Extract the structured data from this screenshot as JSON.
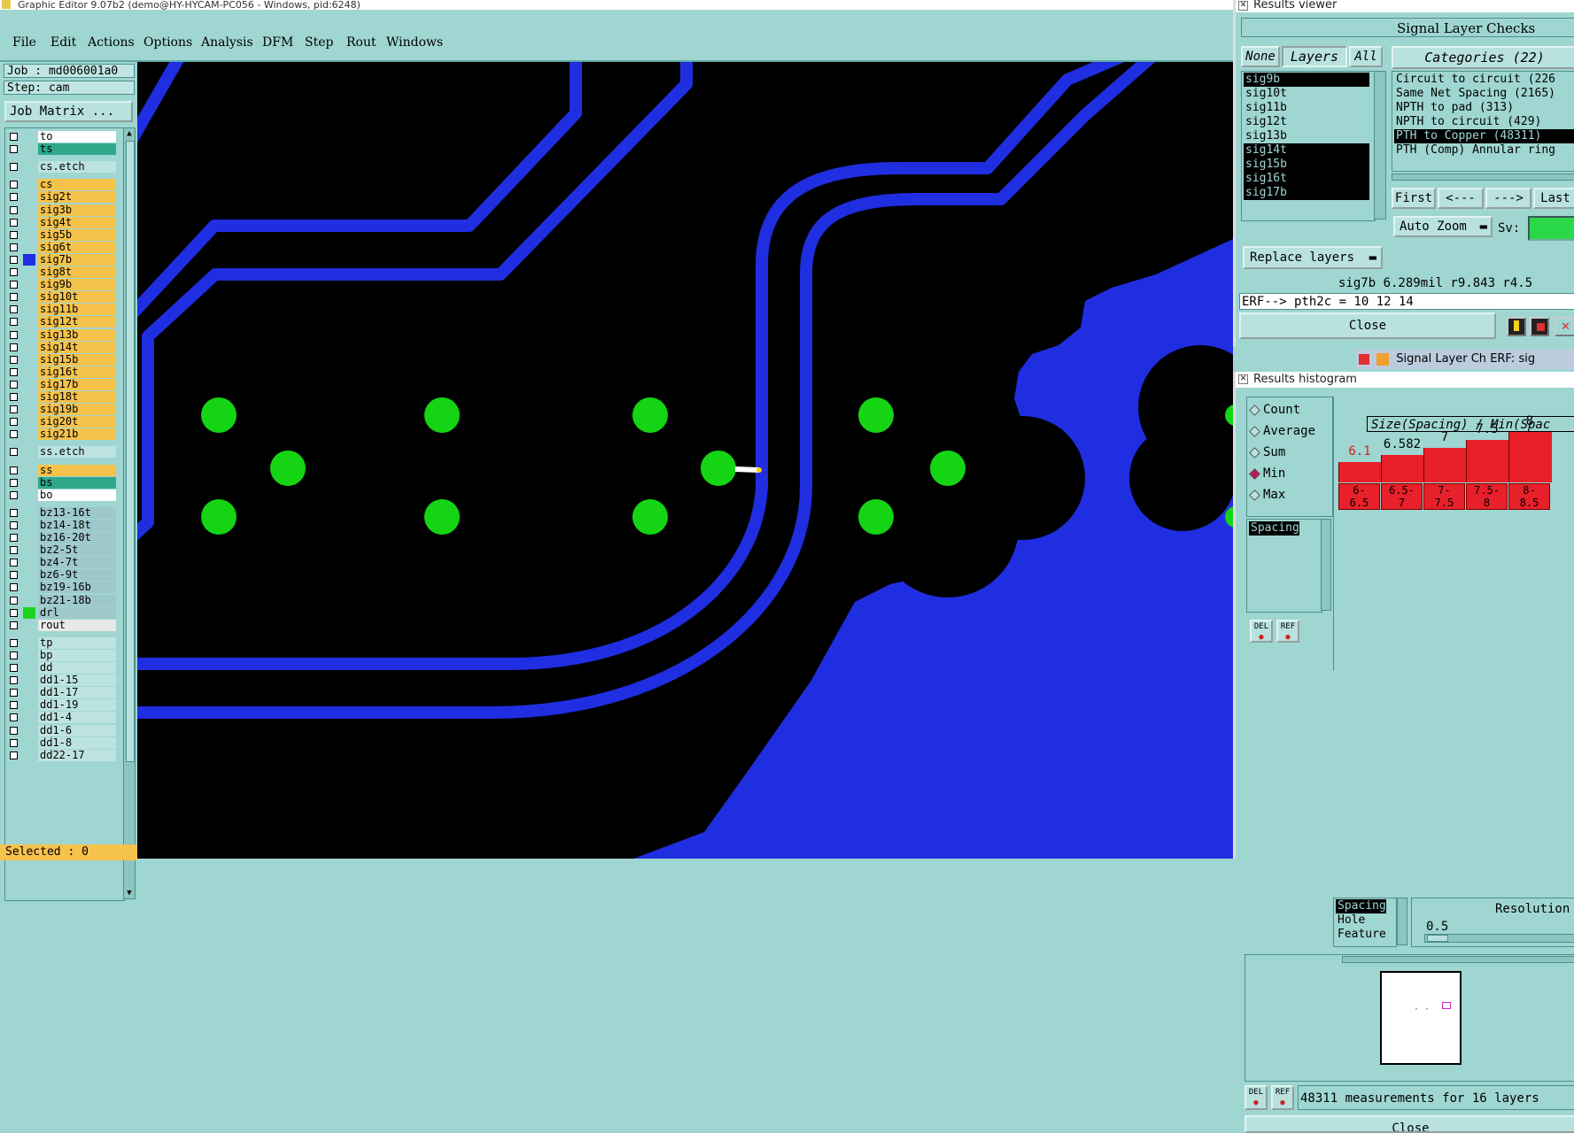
{
  "main_window": {
    "title": "Graphic Editor 9.07b2 (demo@HY-HYCAM-PC056 - Windows, pid:6248)",
    "menu": [
      "File",
      "Edit",
      "Actions",
      "Options",
      "Analysis",
      "DFM",
      "Step",
      "Rout",
      "Windows"
    ]
  },
  "left_panel": {
    "job": "Job : md006001a0",
    "step": "Step: cam",
    "job_matrix": "Job Matrix ...",
    "selected": "Selected : 0",
    "layers": [
      {
        "name": "to",
        "color": "#ffffff"
      },
      {
        "name": "ts",
        "color": "#2fa88c"
      },
      {
        "name": "cs.etch",
        "color": "#bde3e0"
      },
      {
        "name": "cs",
        "color": "#f5c24c"
      },
      {
        "name": "sig2t",
        "color": "#f5c24c"
      },
      {
        "name": "sig3b",
        "color": "#f5c24c"
      },
      {
        "name": "sig4t",
        "color": "#f5c24c"
      },
      {
        "name": "sig5b",
        "color": "#f5c24c"
      },
      {
        "name": "sig6t",
        "color": "#f5c24c"
      },
      {
        "name": "sig7b",
        "color": "#f5c24c",
        "swatch": "#1f2ee0"
      },
      {
        "name": "sig8t",
        "color": "#f5c24c"
      },
      {
        "name": "sig9b",
        "color": "#f5c24c"
      },
      {
        "name": "sig10t",
        "color": "#f5c24c"
      },
      {
        "name": "sig11b",
        "color": "#f5c24c"
      },
      {
        "name": "sig12t",
        "color": "#f5c24c"
      },
      {
        "name": "sig13b",
        "color": "#f5c24c"
      },
      {
        "name": "sig14t",
        "color": "#f5c24c"
      },
      {
        "name": "sig15b",
        "color": "#f5c24c"
      },
      {
        "name": "sig16t",
        "color": "#f5c24c"
      },
      {
        "name": "sig17b",
        "color": "#f5c24c"
      },
      {
        "name": "sig18t",
        "color": "#f5c24c"
      },
      {
        "name": "sig19b",
        "color": "#f5c24c"
      },
      {
        "name": "sig20t",
        "color": "#f5c24c"
      },
      {
        "name": "sig21b",
        "color": "#f5c24c"
      },
      {
        "name": "ss.etch",
        "color": "#bde3e0"
      },
      {
        "name": "ss",
        "color": "#f5c24c"
      },
      {
        "name": "bs",
        "color": "#2fa88c"
      },
      {
        "name": "bo",
        "color": "#ffffff"
      },
      {
        "name": "bz13-16t",
        "color": "#9ec8cc"
      },
      {
        "name": "bz14-18t",
        "color": "#9ec8cc"
      },
      {
        "name": "bz16-20t",
        "color": "#9ec8cc"
      },
      {
        "name": "bz2-5t",
        "color": "#9ec8cc"
      },
      {
        "name": "bz4-7t",
        "color": "#9ec8cc"
      },
      {
        "name": "bz6-9t",
        "color": "#9ec8cc"
      },
      {
        "name": "bz19-16b",
        "color": "#9ec8cc"
      },
      {
        "name": "bz21-18b",
        "color": "#9ec8cc"
      },
      {
        "name": "drl",
        "color": "#9ec8cc",
        "swatch": "#1dd41d"
      },
      {
        "name": "rout",
        "color": "#e8e8e8"
      },
      {
        "name": "tp",
        "color": "#bde3e0"
      },
      {
        "name": "bp",
        "color": "#bde3e0"
      },
      {
        "name": "dd",
        "color": "#bde3e0"
      },
      {
        "name": "dd1-15",
        "color": "#bde3e0"
      },
      {
        "name": "dd1-17",
        "color": "#bde3e0"
      },
      {
        "name": "dd1-19",
        "color": "#bde3e0"
      },
      {
        "name": "dd1-4",
        "color": "#bde3e0"
      },
      {
        "name": "dd1-6",
        "color": "#bde3e0"
      },
      {
        "name": "dd1-8",
        "color": "#bde3e0"
      },
      {
        "name": "dd22-17",
        "color": "#bde3e0"
      }
    ]
  },
  "results_viewer": {
    "title": "Results viewer",
    "check_name": "Signal Layer Checks",
    "btn_none": "None",
    "btn_layers": "Layers",
    "btn_all": "All",
    "categories_label": "Categories (22)",
    "layers": [
      {
        "name": "sig9b",
        "selected": true
      },
      {
        "name": "sig10t",
        "selected": false
      },
      {
        "name": "sig11b",
        "selected": false
      },
      {
        "name": "sig12t",
        "selected": false
      },
      {
        "name": "sig13b",
        "selected": false
      },
      {
        "name": "sig14t",
        "selected": true
      },
      {
        "name": "sig15b",
        "selected": true
      },
      {
        "name": "sig16t",
        "selected": true
      },
      {
        "name": "sig17b",
        "selected": true
      }
    ],
    "categories": [
      {
        "name": "Circuit to circuit (226",
        "selected": false
      },
      {
        "name": "Same Net Spacing (2165)",
        "selected": false
      },
      {
        "name": "NPTH to pad (313)",
        "selected": false
      },
      {
        "name": "NPTH to circuit (429)",
        "selected": false
      },
      {
        "name": "PTH to Copper (48311)",
        "selected": true
      },
      {
        "name": "PTH (Comp) Annular ring",
        "selected": false
      }
    ],
    "nav": {
      "first": "First",
      "prev": "<---",
      "next": "--->",
      "last": "Last"
    },
    "auto_zoom": "Auto Zoom",
    "sv_label": "Sv:",
    "replace_layers": "Replace layers",
    "status": "sig7b 6.289mil  r9.843  r4.5",
    "erf": "ERF--> pth2c = 10 12 14",
    "close": "Close",
    "tab_partial": "Signal Layer Ch",
    "tab_partial2": "ERF:",
    "tab_partial3": "sig"
  },
  "histogram": {
    "title": "Results histogram",
    "modes": [
      {
        "label": "Count",
        "on": false
      },
      {
        "label": "Average",
        "on": false
      },
      {
        "label": "Sum",
        "on": false
      },
      {
        "label": "Min",
        "on": true
      },
      {
        "label": "Max",
        "on": false
      }
    ],
    "left_list_item": "Spacing",
    "header": "Size(Spacing) / Min(Spac",
    "bars": [
      {
        "label": "6.1",
        "value": 6.1,
        "range": "6-\n6.5",
        "red": true
      },
      {
        "label": "6.582",
        "value": 6.582,
        "range": "6.5-\n7"
      },
      {
        "label": "7",
        "value": 7,
        "range": "7-\n7.5"
      },
      {
        "label": "7.5",
        "value": 7.5,
        "range": "7.5-\n8"
      },
      {
        "label": "8",
        "value": 8,
        "range": "8-\n8.5"
      }
    ],
    "y_min": 5.5,
    "y_max": 8,
    "attr_list": [
      "Spacing",
      "Hole",
      "Feature"
    ],
    "resolution_label": "Resolution",
    "resolution_value": "0.5",
    "measurements": "48311 measurements for 16 layers",
    "close_partial": "Close",
    "del": "DEL",
    "ref": "REF"
  }
}
